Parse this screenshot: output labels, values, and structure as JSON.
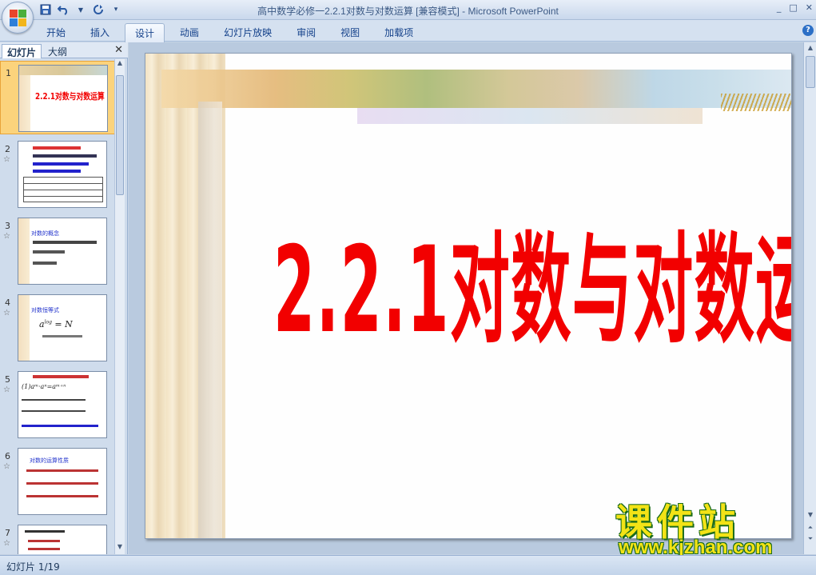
{
  "window": {
    "title": "高中数学必修一2.2.1对数与对数运算 [兼容模式] - Microsoft PowerPoint",
    "controls": [
      "_",
      "□",
      "✕"
    ]
  },
  "quick_access": [
    "save-icon",
    "undo-icon",
    "redo-icon",
    "customize-icon"
  ],
  "ribbon": {
    "tabs": [
      "开始",
      "插入",
      "设计",
      "动画",
      "幻灯片放映",
      "审阅",
      "视图",
      "加载项"
    ],
    "active_tab": "设计",
    "help": "?"
  },
  "left_pane": {
    "tabs": [
      "幻灯片",
      "大纲"
    ],
    "active_tab": "幻灯片",
    "close": "✕",
    "slides": [
      {
        "number": "1",
        "star": "",
        "text": "2.2.1对数与对数运算"
      },
      {
        "number": "2",
        "star": "☆",
        "text": ""
      },
      {
        "number": "3",
        "star": "☆",
        "text": "对数的概念"
      },
      {
        "number": "4",
        "star": "☆",
        "text": "对数恒等式"
      },
      {
        "number": "5",
        "star": "☆",
        "text": "(1)aᵐ·aⁿ=aᵐ⁺ⁿ"
      },
      {
        "number": "6",
        "star": "☆",
        "text": "对数的运算性质"
      },
      {
        "number": "7",
        "star": "☆",
        "text": ""
      }
    ],
    "selected_slide": "1"
  },
  "slide": {
    "title": "2.2.1对数与对数运算"
  },
  "watermark": {
    "brand": "课件站",
    "url": "www.kjzhan.com"
  },
  "status": {
    "slide_count": "幻灯片 1/19"
  },
  "colors": {
    "title_red": "#f20000",
    "selected_thumb": "#fbd37c",
    "ribbon_text": "#15428b"
  }
}
